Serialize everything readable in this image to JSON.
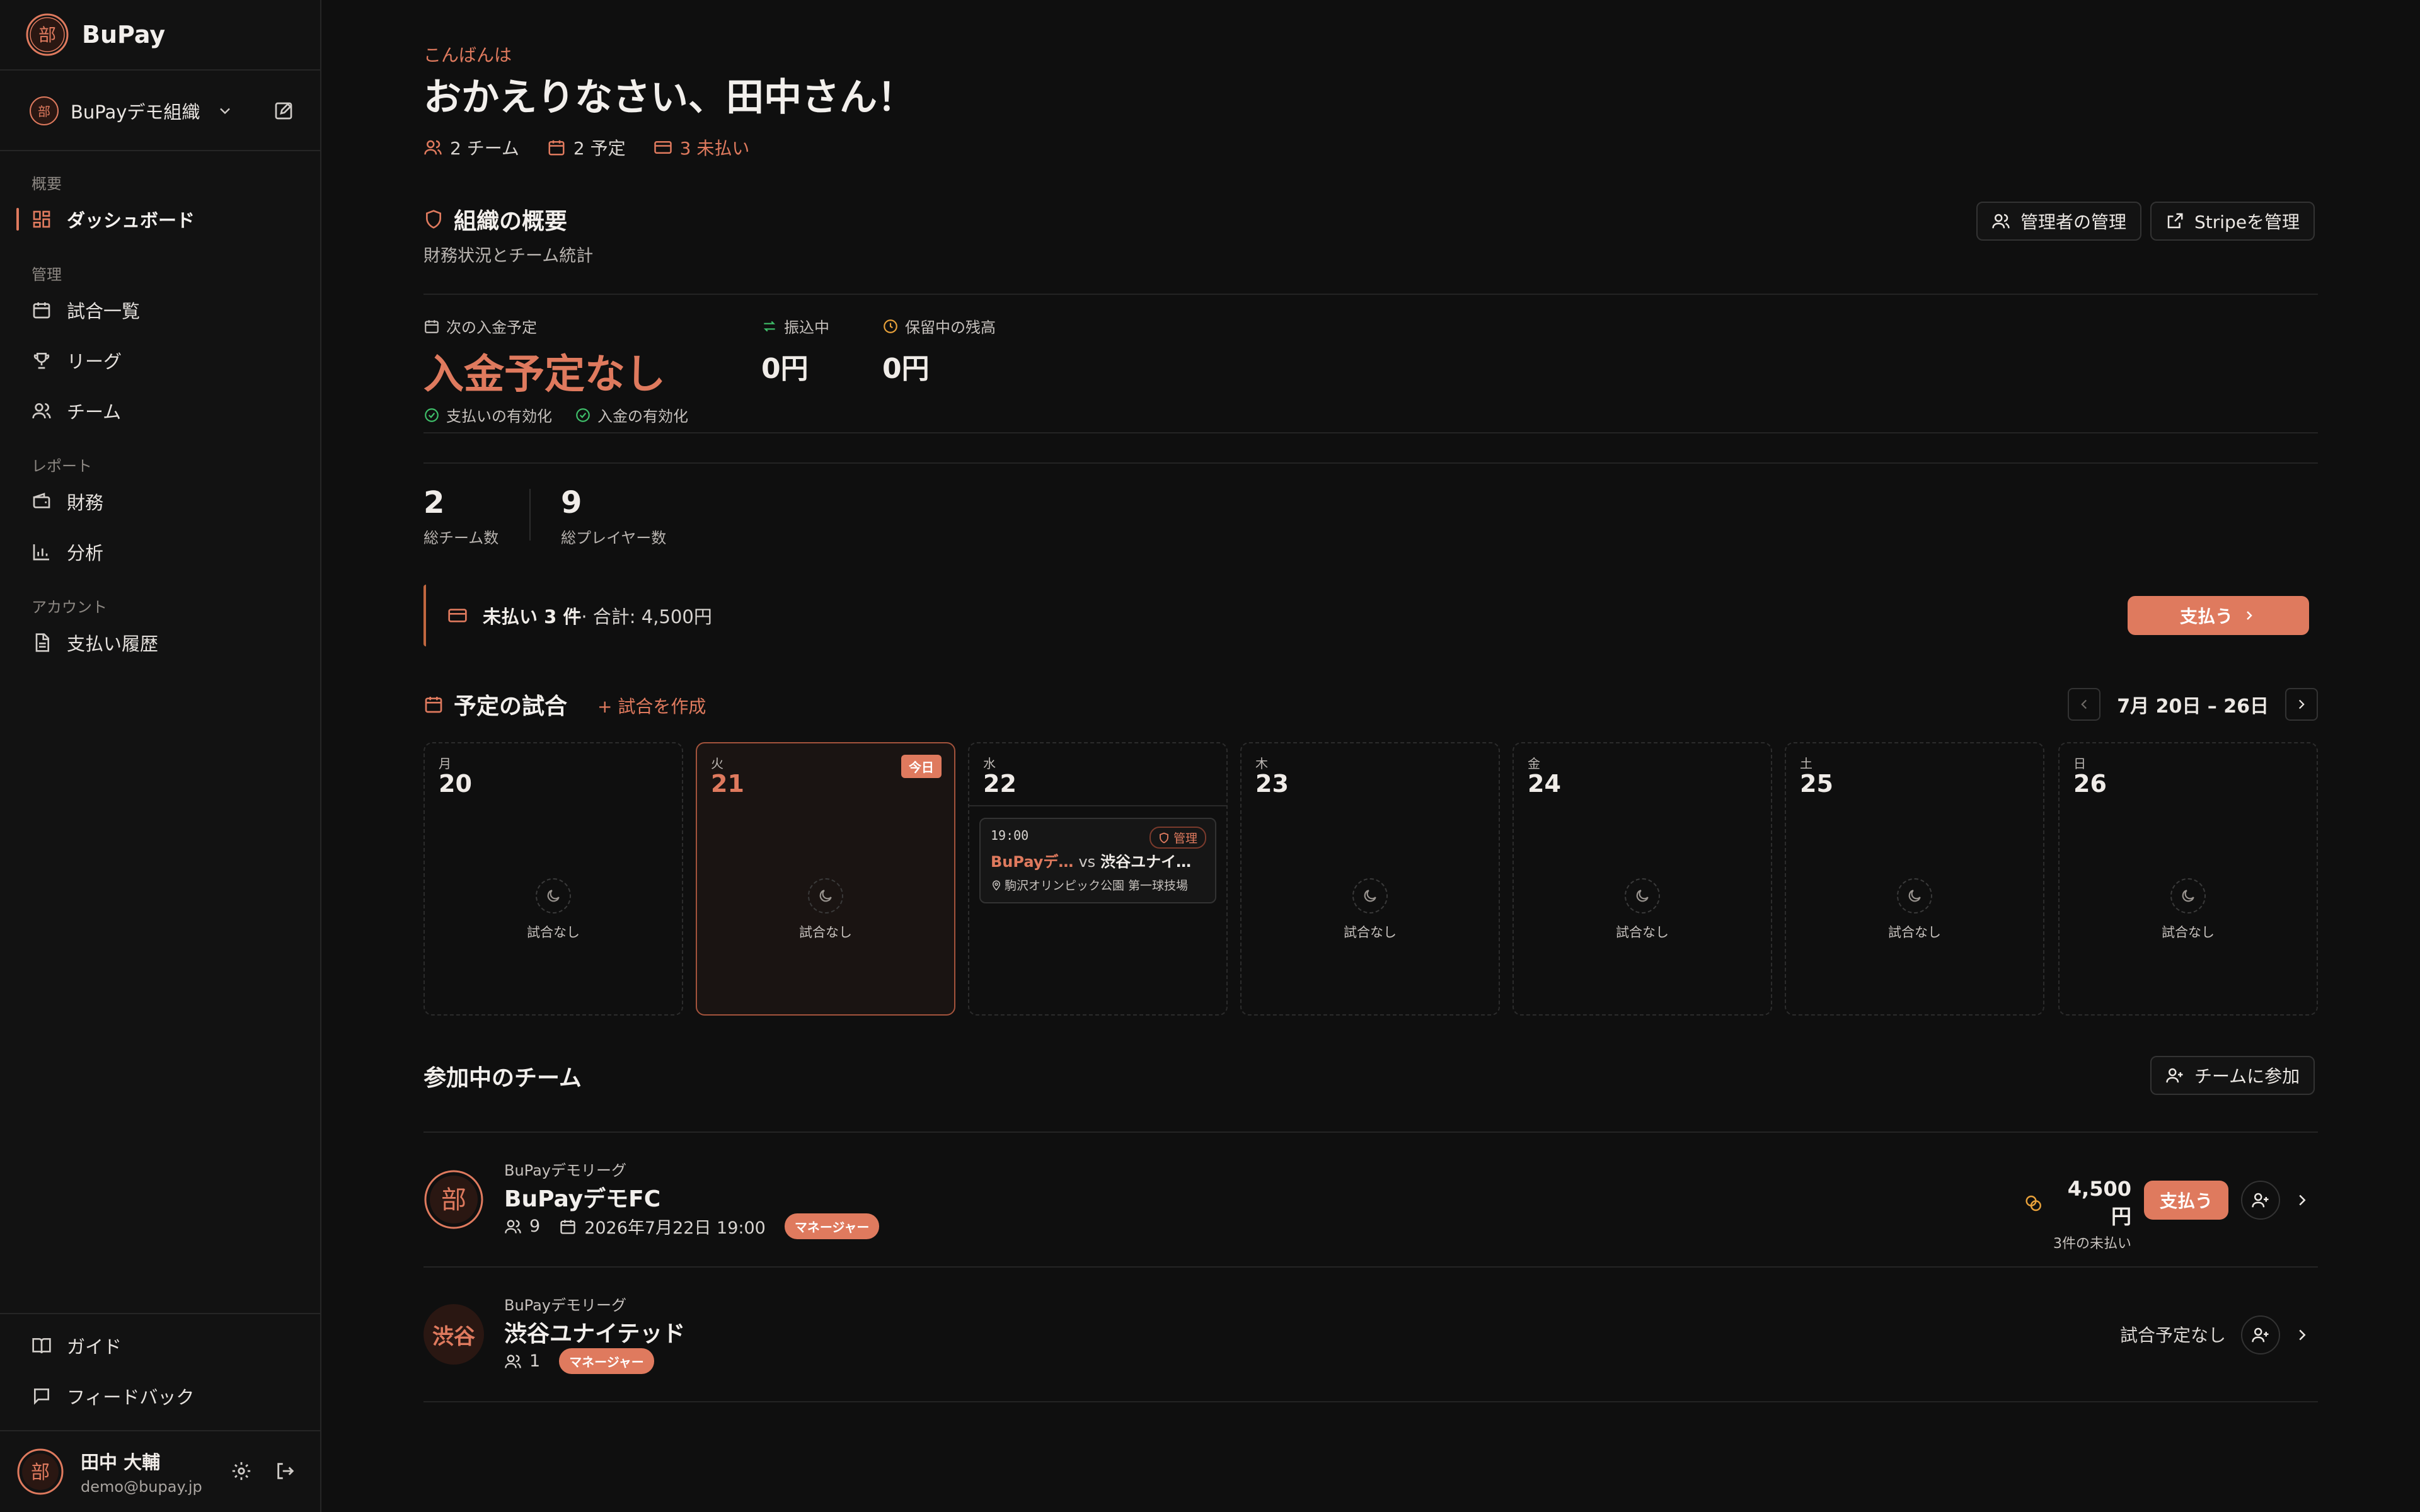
{
  "app": {
    "name": "BuPay"
  },
  "sidebar": {
    "org_name": "BuPayデモ組織",
    "sections": {
      "overview": "概要",
      "manage": "管理",
      "report": "レポート",
      "account": "アカウント"
    },
    "items": {
      "dashboard": "ダッシュボード",
      "matches": "試合一覧",
      "league": "リーグ",
      "team": "チーム",
      "finance": "財務",
      "analytics": "分析",
      "payments": "支払い履歴",
      "guide": "ガイド",
      "feedback": "フィードバック"
    },
    "user": {
      "name": "田中 大輔",
      "email": "demo@bupay.jp"
    }
  },
  "header": {
    "greeting": "こんばんは",
    "welcome": "おかえりなさい、田中さん！",
    "stats": {
      "teams": "2 チーム",
      "scheduled": "2 予定",
      "unpaid": "3 未払い"
    }
  },
  "org_overview": {
    "title": "組織の概要",
    "subtitle": "財務状況とチーム統計",
    "manage_admins": "管理者の管理",
    "manage_stripe": "Stripeを管理",
    "next_payout_label": "次の入金予定",
    "next_payout_value": "入金予定なし",
    "payments_enabled": "支払いの有効化",
    "payouts_enabled": "入金の有効化",
    "in_transit_label": "振込中",
    "in_transit_value": "0円",
    "held_label": "保留中の残高",
    "held_value": "0円",
    "total_teams": "2",
    "total_teams_label": "総チーム数",
    "total_players": "9",
    "total_players_label": "総プレイヤー数"
  },
  "unpaid_banner": {
    "label": "未払い 3 件",
    "total": " · 合計: 4,500円",
    "pay_button": "支払う"
  },
  "schedule": {
    "title": "予定の試合",
    "create": "+ 試合を作成",
    "week_label": "7月 20日 – 26日",
    "today_badge": "今日",
    "empty_text": "試合なし",
    "days": [
      {
        "weekday": "月",
        "date": "20"
      },
      {
        "weekday": "火",
        "date": "21"
      },
      {
        "weekday": "水",
        "date": "22"
      },
      {
        "weekday": "木",
        "date": "23"
      },
      {
        "weekday": "金",
        "date": "24"
      },
      {
        "weekday": "土",
        "date": "25"
      },
      {
        "weekday": "日",
        "date": "26"
      }
    ],
    "match": {
      "time": "19:00",
      "badge": "管理",
      "home": "BuPayデ…",
      "vs": "vs",
      "away": "渋谷ユナイ…",
      "location": "駒沢オリンピック公園 第一球技場"
    }
  },
  "teams": {
    "title": "参加中のチーム",
    "join_button": "チームに参加",
    "list": [
      {
        "league": "BuPayデモリーグ",
        "name": "BuPayデモFC",
        "members": "9",
        "next_match": "2026年7月22日 19:00",
        "role": "マネージャー",
        "amount": "4,500円",
        "unpaid_note": "3件の未払い",
        "pay_button": "支払う"
      },
      {
        "league": "BuPayデモリーグ",
        "name": "渋谷ユナイテッド",
        "logo_text": "渋谷",
        "members": "1",
        "role": "マネージャー",
        "status": "試合予定なし"
      }
    ]
  },
  "colors": {
    "accent": "#df7a5e",
    "background": "#0f0f0f",
    "sidebar": "#121212",
    "success": "#3fbf6a"
  }
}
